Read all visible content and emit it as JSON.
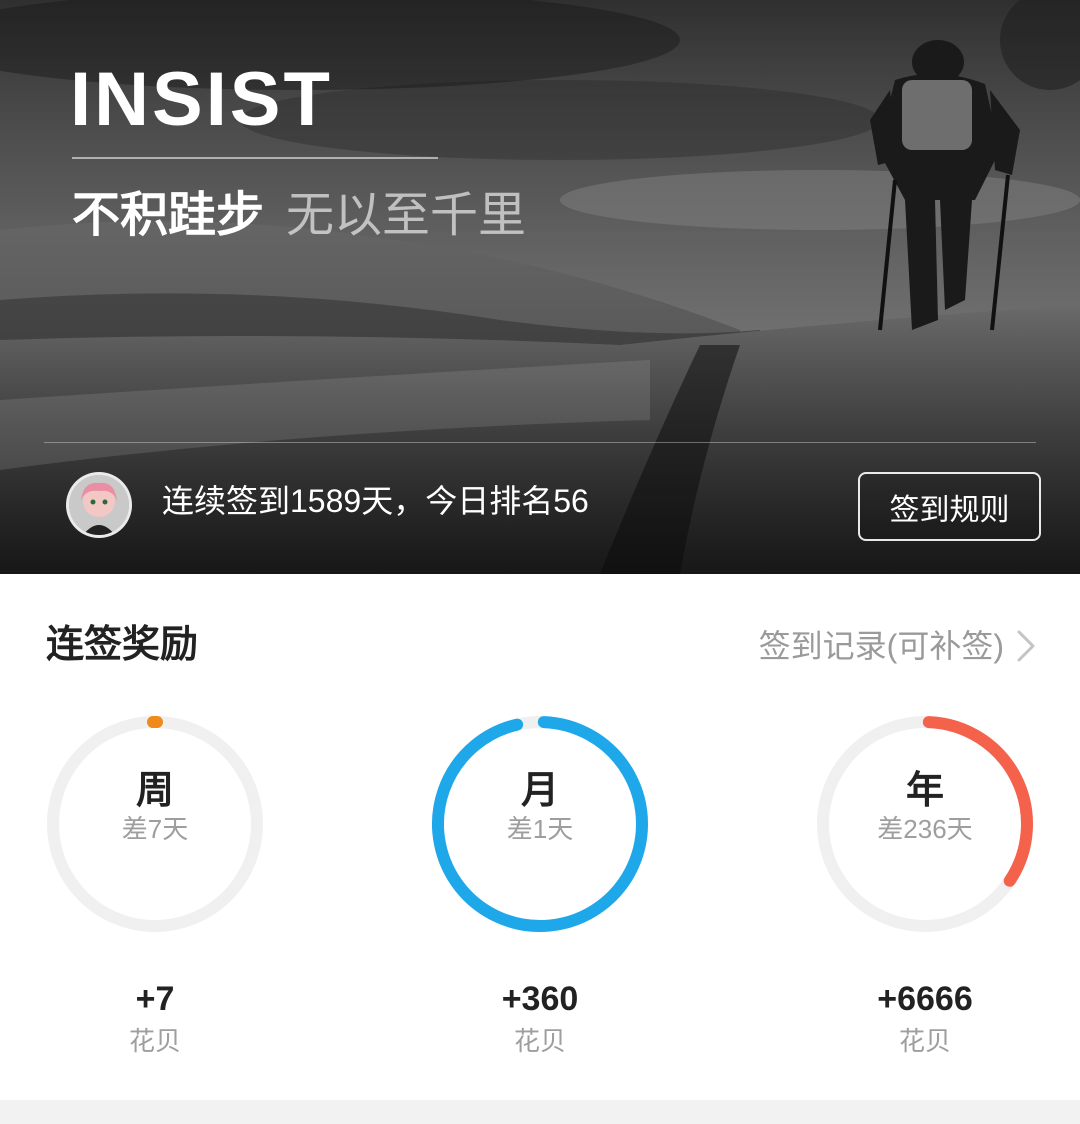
{
  "hero": {
    "title": "INSIST",
    "subtitle_strong": "不积跬步",
    "subtitle_light": "无以至千里",
    "streak_text": "连续签到1589天，今日排名56",
    "rules_button": "签到规则",
    "avatar_icon": "user-avatar-icon"
  },
  "rewards": {
    "title": "连签奖励",
    "records_link": "签到记录(可补签)",
    "records_icon": "chevron-right-icon",
    "rings": [
      {
        "label": "周",
        "remaining": "差7天",
        "reward": "+7",
        "unit": "花贝",
        "progress": 0.0,
        "color": "#f08a1c"
      },
      {
        "label": "月",
        "remaining": "差1天",
        "reward": "+360",
        "unit": "花贝",
        "progress": 0.97,
        "color": "#1ea8ea"
      },
      {
        "label": "年",
        "remaining": "差236天",
        "reward": "+6666",
        "unit": "花贝",
        "progress": 0.35,
        "color": "#f4624b"
      }
    ],
    "track_color": "#f0f0f0"
  }
}
